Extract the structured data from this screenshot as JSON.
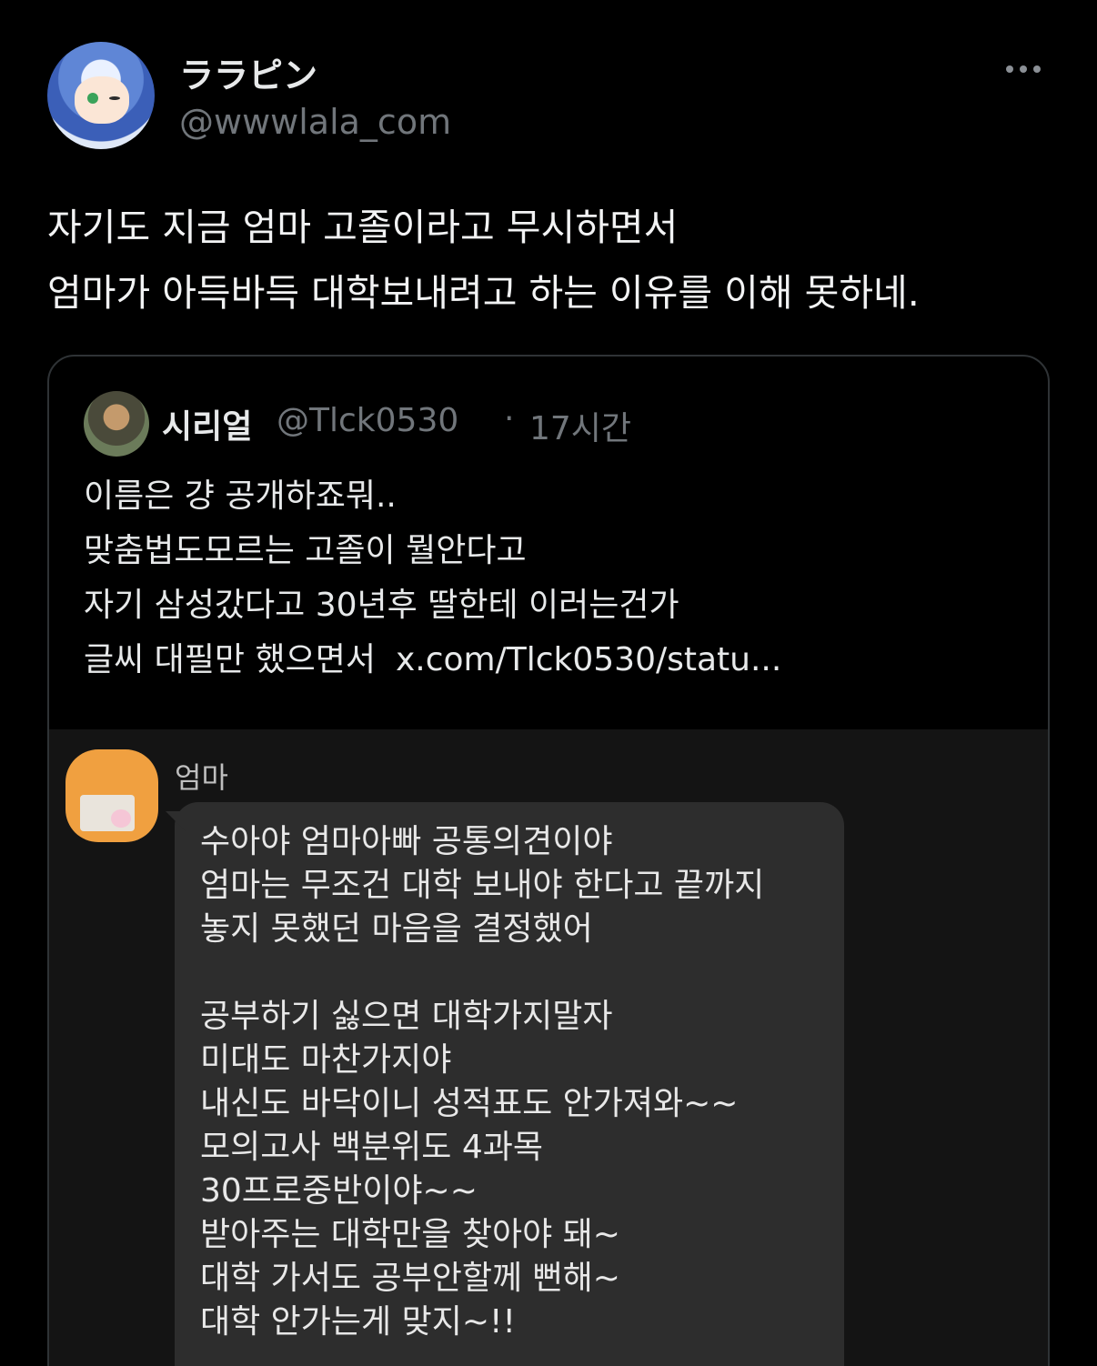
{
  "tweet": {
    "author": {
      "display_name": "ララピン",
      "handle": "@wwwlala_com"
    },
    "text_lines": [
      "자기도 지금 엄마 고졸이라고 무시하면서",
      "엄마가 아득바득 대학보내려고 하는 이유를 이해 못하네."
    ],
    "more_icon": "more-horizontal-icon"
  },
  "quote": {
    "author": {
      "display_name": "시리얼",
      "handle": "@Tlck0530",
      "separator": "·",
      "time": "17시간"
    },
    "text_lines": [
      "이름은 걍 공개하죠뭐..",
      "맞춤법도모르는 고졸이 뭘안다고",
      "자기 삼성갔다고 30년후 딸한테 이러는건가",
      "글씨 대필만 했으면서"
    ],
    "link": "x.com/Tlck0530/statu...",
    "media": {
      "sender": "엄마",
      "message_block1": [
        "수아야 엄마아빠 공통의견이야",
        "엄마는 무조건 대학 보내야 한다고 끝까지",
        "놓지 못했던 마음을 결정했어"
      ],
      "message_block2": [
        "공부하기 싫으면 대학가지말자",
        "미대도 마찬가지야",
        "내신도 바닥이니 성적표도 안가져와~~",
        "모의고사 백분위도 4과목",
        "30프로중반이야~~",
        "받아주는 대학만을 찾아야 돼~",
        "대학 가서도 공부안할께 뻔해~",
        "대학 안가는게 맞지~!!"
      ]
    }
  }
}
